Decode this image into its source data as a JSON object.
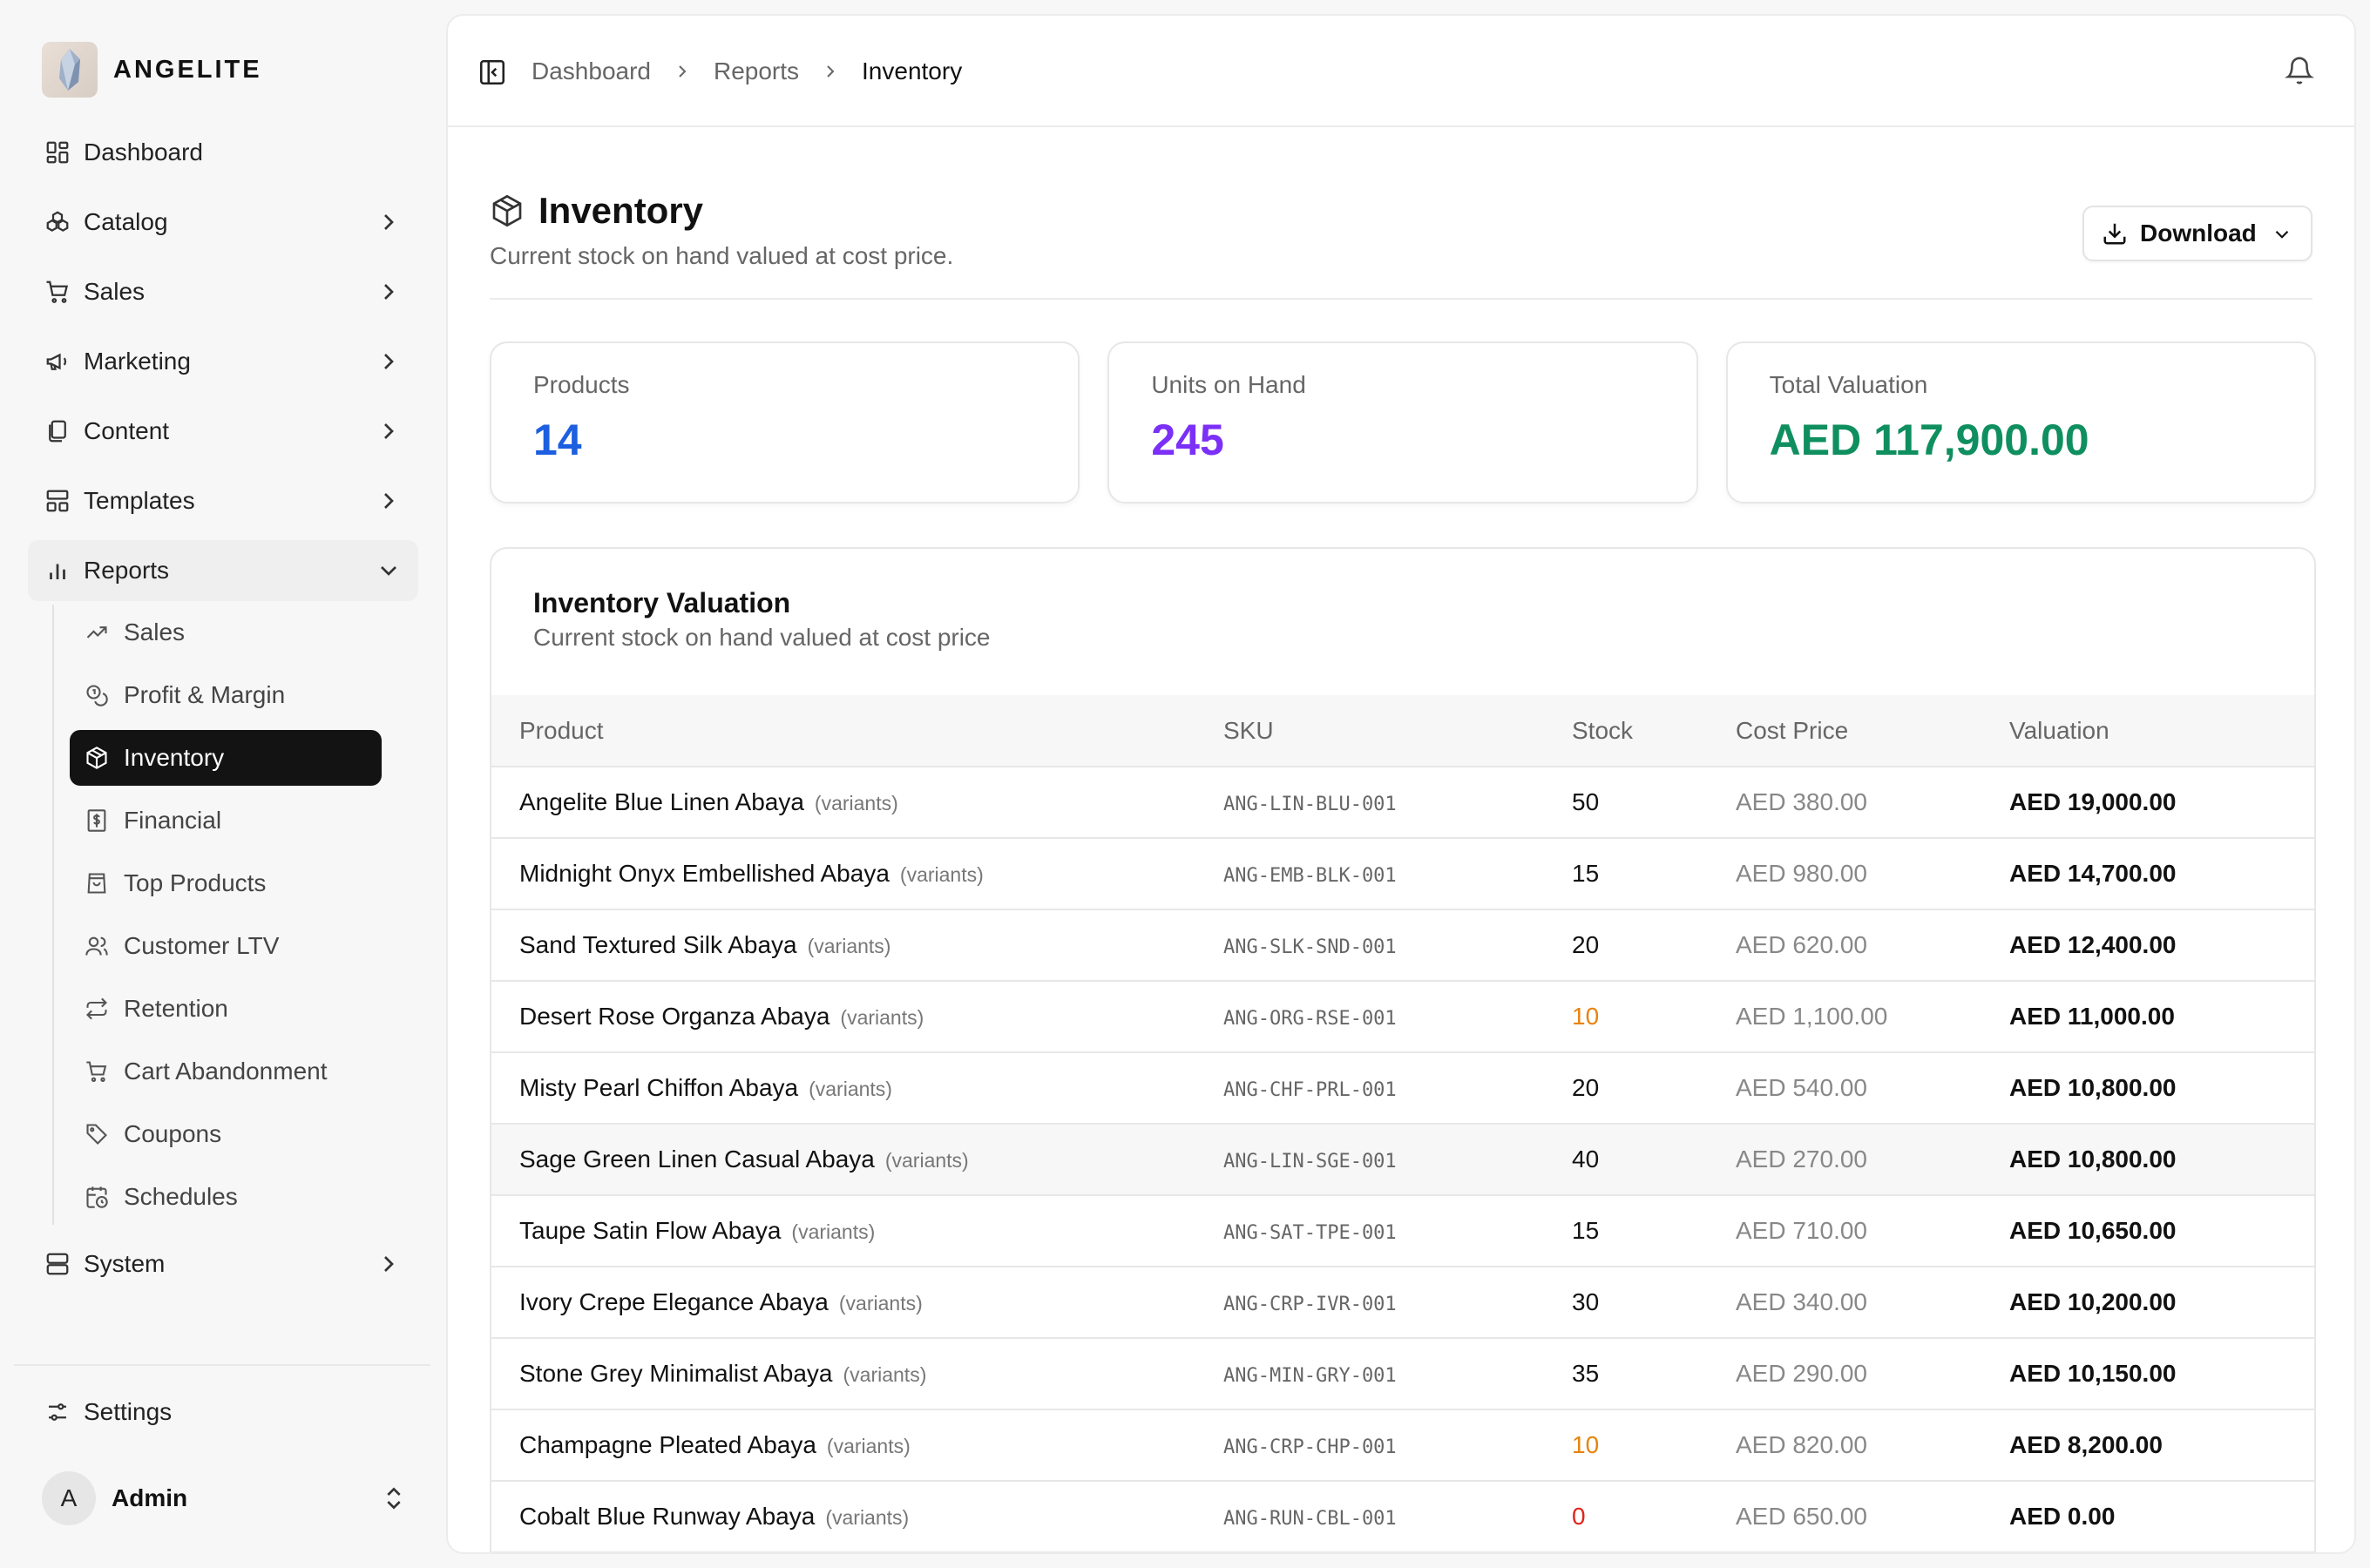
{
  "brand": {
    "name": "ANGELITE"
  },
  "nav": [
    {
      "label": "Dashboard",
      "icon": "dashboard-icon",
      "has_chevron": false
    },
    {
      "label": "Catalog",
      "icon": "catalog-icon",
      "has_chevron": true
    },
    {
      "label": "Sales",
      "icon": "cart-icon",
      "has_chevron": true
    },
    {
      "label": "Marketing",
      "icon": "megaphone-icon",
      "has_chevron": true
    },
    {
      "label": "Content",
      "icon": "files-icon",
      "has_chevron": true
    },
    {
      "label": "Templates",
      "icon": "templates-icon",
      "has_chevron": true
    },
    {
      "label": "Reports",
      "icon": "bar-chart-icon",
      "expanded": true
    }
  ],
  "reports_sub": [
    {
      "label": "Sales",
      "icon": "trend-up-icon"
    },
    {
      "label": "Profit & Margin",
      "icon": "coins-icon"
    },
    {
      "label": "Inventory",
      "icon": "box-icon",
      "active": true
    },
    {
      "label": "Financial",
      "icon": "receipt-icon"
    },
    {
      "label": "Top Products",
      "icon": "shopping-bag-icon"
    },
    {
      "label": "Customer LTV",
      "icon": "users-icon"
    },
    {
      "label": "Retention",
      "icon": "repeat-icon"
    },
    {
      "label": "Cart Abandonment",
      "icon": "cart-icon"
    },
    {
      "label": "Coupons",
      "icon": "tag-icon"
    },
    {
      "label": "Schedules",
      "icon": "calendar-clock-icon"
    }
  ],
  "system": {
    "label": "System",
    "icon": "server-icon"
  },
  "settings": {
    "label": "Settings",
    "icon": "sliders-icon"
  },
  "user": {
    "initial": "A",
    "name": "Admin"
  },
  "breadcrumb": [
    "Dashboard",
    "Reports",
    "Inventory"
  ],
  "page": {
    "title": "Inventory",
    "subtitle": "Current stock on hand valued at cost price.",
    "download_label": "Download"
  },
  "stats": [
    {
      "label": "Products",
      "value": "14",
      "color": "#1d5fe0"
    },
    {
      "label": "Units on Hand",
      "value": "245",
      "color": "#7b2ff7"
    },
    {
      "label": "Total Valuation",
      "value": "AED 117,900.00",
      "color": "#0f8f5f"
    }
  ],
  "table": {
    "title": "Inventory Valuation",
    "subtitle": "Current stock on hand valued at cost price",
    "columns": [
      "Product",
      "SKU",
      "Stock",
      "Cost Price",
      "Valuation"
    ],
    "variant_tag": "(variants)",
    "rows": [
      {
        "product": "Angelite Blue Linen Abaya",
        "sku": "ANG-LIN-BLU-001",
        "stock": "50",
        "stock_status": "normal",
        "cost": "AED 380.00",
        "valuation": "AED 19,000.00"
      },
      {
        "product": "Midnight Onyx Embellished Abaya",
        "sku": "ANG-EMB-BLK-001",
        "stock": "15",
        "stock_status": "normal",
        "cost": "AED 980.00",
        "valuation": "AED 14,700.00"
      },
      {
        "product": "Sand Textured Silk Abaya",
        "sku": "ANG-SLK-SND-001",
        "stock": "20",
        "stock_status": "normal",
        "cost": "AED 620.00",
        "valuation": "AED 12,400.00"
      },
      {
        "product": "Desert Rose Organza Abaya",
        "sku": "ANG-ORG-RSE-001",
        "stock": "10",
        "stock_status": "low",
        "cost": "AED 1,100.00",
        "valuation": "AED 11,000.00"
      },
      {
        "product": "Misty Pearl Chiffon Abaya",
        "sku": "ANG-CHF-PRL-001",
        "stock": "20",
        "stock_status": "normal",
        "cost": "AED 540.00",
        "valuation": "AED 10,800.00"
      },
      {
        "product": "Sage Green Linen Casual Abaya",
        "sku": "ANG-LIN-SGE-001",
        "stock": "40",
        "stock_status": "normal",
        "cost": "AED 270.00",
        "valuation": "AED 10,800.00",
        "hover": true
      },
      {
        "product": "Taupe Satin Flow Abaya",
        "sku": "ANG-SAT-TPE-001",
        "stock": "15",
        "stock_status": "normal",
        "cost": "AED 710.00",
        "valuation": "AED 10,650.00"
      },
      {
        "product": "Ivory Crepe Elegance Abaya",
        "sku": "ANG-CRP-IVR-001",
        "stock": "30",
        "stock_status": "normal",
        "cost": "AED 340.00",
        "valuation": "AED 10,200.00"
      },
      {
        "product": "Stone Grey Minimalist Abaya",
        "sku": "ANG-MIN-GRY-001",
        "stock": "35",
        "stock_status": "normal",
        "cost": "AED 290.00",
        "valuation": "AED 10,150.00"
      },
      {
        "product": "Champagne Pleated Abaya",
        "sku": "ANG-CRP-CHP-001",
        "stock": "10",
        "stock_status": "low",
        "cost": "AED 820.00",
        "valuation": "AED 8,200.00"
      },
      {
        "product": "Cobalt Blue Runway Abaya",
        "sku": "ANG-RUN-CBL-001",
        "stock": "0",
        "stock_status": "out",
        "cost": "AED 650.00",
        "valuation": "AED 0.00"
      }
    ]
  },
  "colors": {
    "stock_low": "#e8830c",
    "stock_out": "#e0241b",
    "active_nav_bg": "#131313"
  }
}
